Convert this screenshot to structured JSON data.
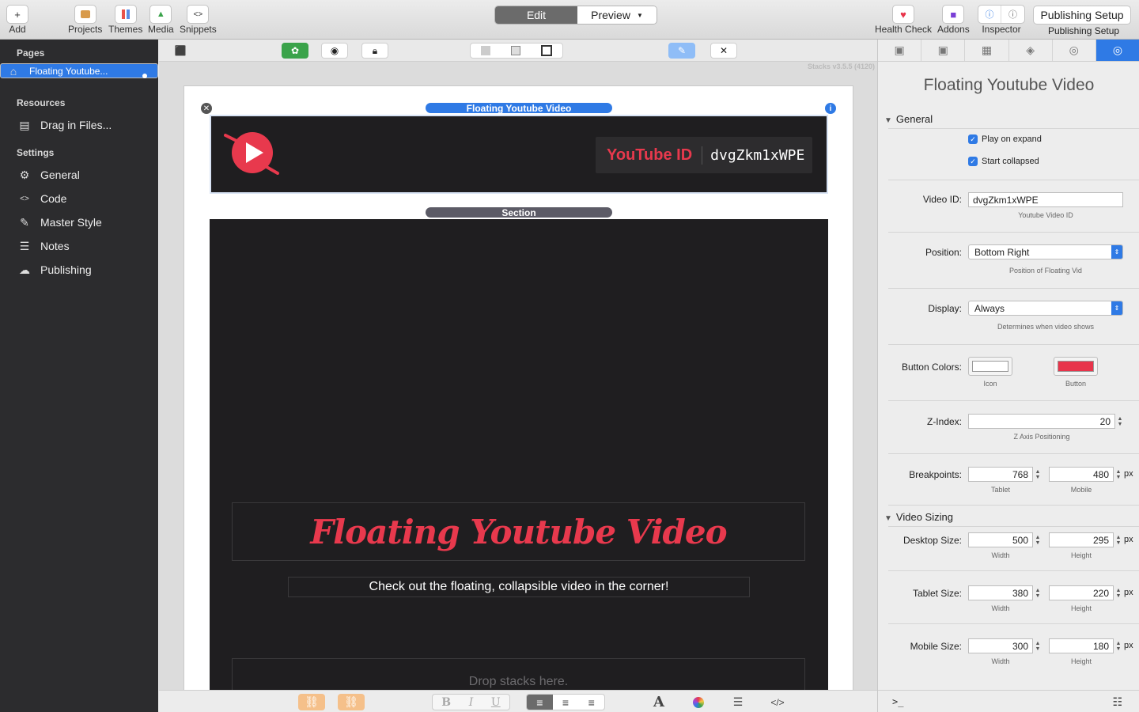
{
  "toolbar": {
    "add": "Add",
    "projects": "Projects",
    "themes": "Themes",
    "media": "Media",
    "snippets": "Snippets",
    "edit": "Edit",
    "preview": "Preview",
    "health_check": "Health Check",
    "addons": "Addons",
    "inspector": "Inspector",
    "publishing_setup_button": "Publishing Setup",
    "publishing_setup_label": "Publishing Setup"
  },
  "sidebar": {
    "pages_heading": "Pages",
    "page_item": "Floating Youtube...",
    "resources_heading": "Resources",
    "drag_files": "Drag in Files...",
    "settings_heading": "Settings",
    "items": [
      {
        "label": "General",
        "icon": "gear-icon"
      },
      {
        "label": "Code",
        "icon": "code-icon"
      },
      {
        "label": "Master Style",
        "icon": "brush-icon"
      },
      {
        "label": "Notes",
        "icon": "notes-icon"
      },
      {
        "label": "Publishing",
        "icon": "cloud-icon"
      }
    ]
  },
  "editor": {
    "version": "Stacks v3.5.5 (4120)",
    "stack_label": "Floating Youtube Video",
    "youtube_id_label": "YouTube ID",
    "youtube_id_value": "dvgZkm1xWPE",
    "section_label": "Section",
    "title": "Floating Youtube Video",
    "subtitle": "Check out the floating, collapsible video in the corner!",
    "drop_hint": "Drop stacks here."
  },
  "inspector": {
    "title": "Floating Youtube Video",
    "general_heading": "General",
    "play_on_expand": "Play on expand",
    "start_collapsed": "Start collapsed",
    "video_id_label": "Video ID:",
    "video_id_value": "dvgZkm1xWPE",
    "video_id_hint": "Youtube Video ID",
    "position_label": "Position:",
    "position_value": "Bottom Right",
    "position_hint": "Position of Floating Vid",
    "display_label": "Display:",
    "display_value": "Always",
    "display_hint": "Determines when video shows",
    "button_colors_label": "Button Colors:",
    "icon_hint": "Icon",
    "button_hint": "Button",
    "icon_color": "#ffffff",
    "button_color": "#e8344b",
    "zindex_label": "Z-Index:",
    "zindex_value": "20",
    "zindex_hint": "Z Axis Positioning",
    "breakpoints_label": "Breakpoints:",
    "bp_tablet": "768",
    "bp_mobile": "480",
    "tablet_hint": "Tablet",
    "mobile_hint": "Mobile",
    "px": "px",
    "video_sizing_heading": "Video Sizing",
    "desktop_label": "Desktop Size:",
    "desktop_w": "500",
    "desktop_h": "295",
    "tablet_label": "Tablet Size:",
    "tablet_w": "380",
    "tablet_h": "220",
    "mobile_label": "Mobile Size:",
    "mobile_w": "300",
    "mobile_h": "180",
    "width_hint": "Width",
    "height_hint": "Height",
    "console_prompt": ">_"
  },
  "colors": {
    "accent": "#2f7ae5",
    "brand_red": "#e8394d",
    "sidebar_bg": "#2c2c2e"
  }
}
